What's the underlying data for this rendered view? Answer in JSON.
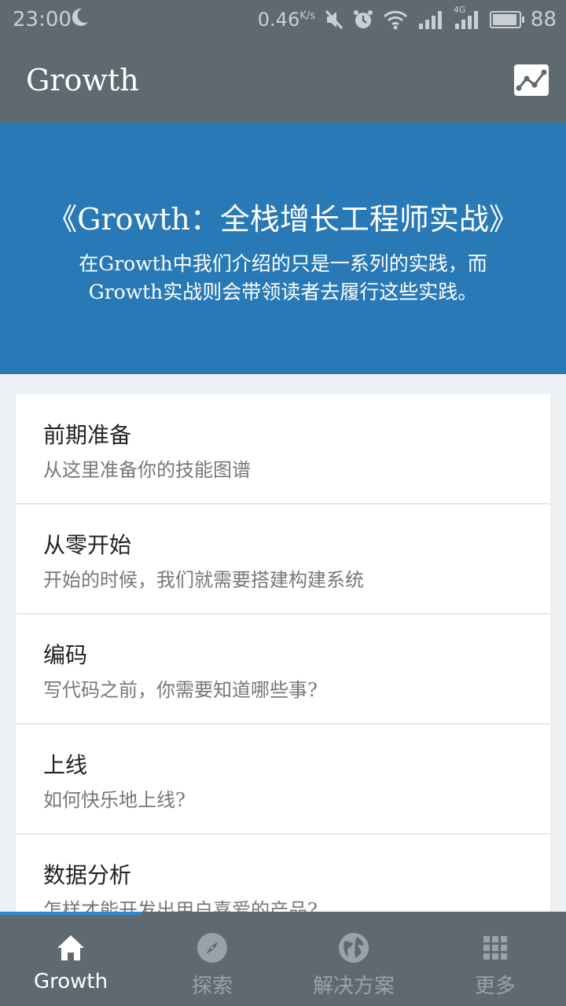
{
  "status_bar": {
    "time": "23:00",
    "speed": "0.46",
    "speed_unit": "K/s",
    "network": "4G",
    "battery": "88"
  },
  "app_bar": {
    "title": "Growth",
    "action_icon": "chart-icon"
  },
  "hero": {
    "title": "《Growth：全栈增长工程师实战》",
    "description_line1": "在Growth中我们介绍的只是一系列的实践，而",
    "description_line2": "Growth实战则会带领读者去履行这些实践。"
  },
  "sections": [
    {
      "title": "前期准备",
      "subtitle": "从这里准备你的技能图谱"
    },
    {
      "title": "从零开始",
      "subtitle": "开始的时候，我们就需要搭建构建系统"
    },
    {
      "title": "编码",
      "subtitle": "写代码之前，你需要知道哪些事?"
    },
    {
      "title": "上线",
      "subtitle": "如何快乐地上线?"
    },
    {
      "title": "数据分析",
      "subtitle": "怎样才能开发出用户喜爱的产品?"
    }
  ],
  "bottom_nav": [
    {
      "label": "Growth",
      "icon": "home-icon",
      "active": true
    },
    {
      "label": "探索",
      "icon": "compass-icon",
      "active": false
    },
    {
      "label": "解决方案",
      "icon": "globe-icon",
      "active": false
    },
    {
      "label": "更多",
      "icon": "grid-icon",
      "active": false
    }
  ],
  "colors": {
    "app_bar": "#5f6970",
    "hero": "#2879b6",
    "accent": "#2a8ad4",
    "background": "#eef1f3"
  }
}
